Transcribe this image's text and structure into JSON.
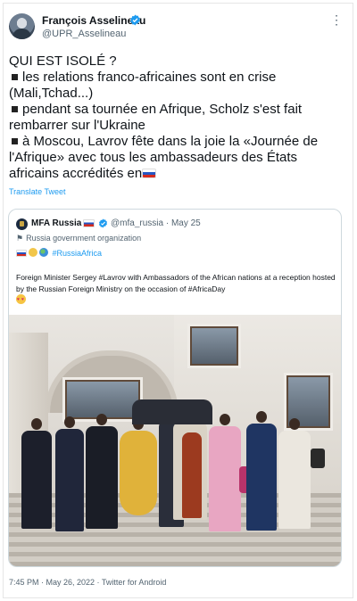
{
  "author": {
    "name": "François Asselineau",
    "handle": "@UPR_Asselineau"
  },
  "tweet": {
    "lines": [
      "QUI EST ISOLÉ ?",
      "les relations franco-africaines sont en crise (Mali,Tchad...)",
      "pendant sa tournée en Afrique, Scholz s'est fait rembarrer sur l'Ukraine",
      "à Moscou, Lavrov fête dans la joie la «Journée de l'Afrique» avec tous les ambassadeurs des États africains accrédités en"
    ],
    "translate_label": "Translate Tweet"
  },
  "quote": {
    "name": "MFA Russia",
    "handle_date": "@mfa_russia · May 25",
    "org_label": "Russia government organization",
    "tagline_hashtag": "#RussiaAfrica",
    "body": "Foreign Minister Sergey #Lavrov with Ambassadors of the African nations at a reception hosted by the Russian Foreign Ministry on the occasion of #AfricaDay",
    "photo_alt": "Group photo on the steps of a building"
  },
  "footer": {
    "timestamp": "7:45 PM · May 26, 2022 · Twitter for Android"
  },
  "icons": {
    "verified": "verified-badge-icon",
    "more": "more-options-icon",
    "flag": "russia-flag-icon"
  },
  "colors": {
    "accent": "#1d9bf0",
    "secondary_text": "#536471",
    "border": "#cfd9de"
  }
}
